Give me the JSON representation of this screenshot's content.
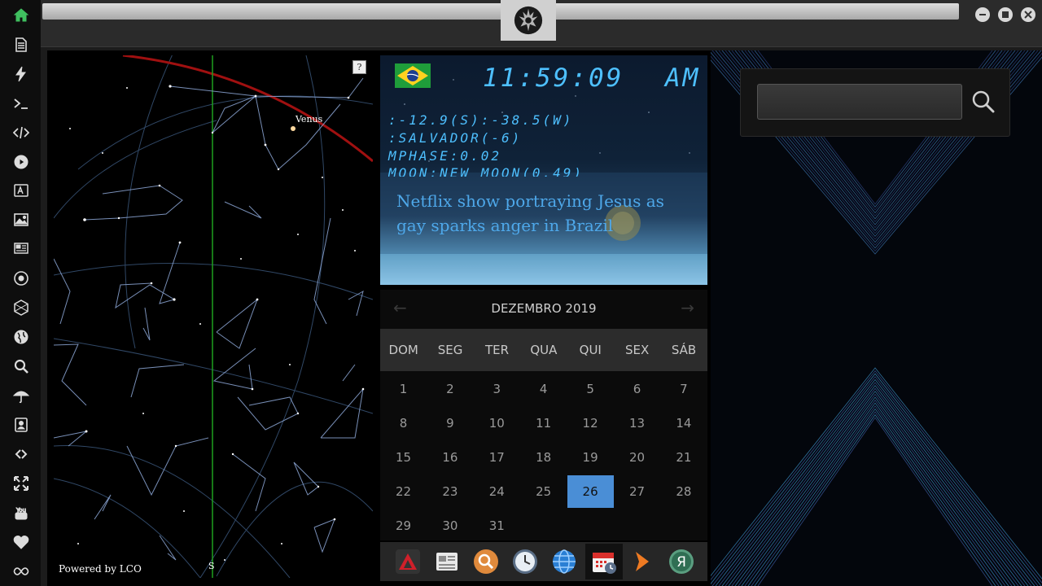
{
  "sidebar": {
    "items": [
      {
        "name": "home-icon",
        "color": "#3fbf5f"
      },
      {
        "name": "document-icon",
        "color": "#dcdcdc"
      },
      {
        "name": "lightning-icon",
        "color": "#dcdcdc"
      },
      {
        "name": "terminal-icon",
        "color": "#dcdcdc"
      },
      {
        "name": "code-icon",
        "color": "#dcdcdc"
      },
      {
        "name": "play-icon",
        "color": "#dcdcdc"
      },
      {
        "name": "translate-icon",
        "color": "#dcdcdc"
      },
      {
        "name": "image-icon",
        "color": "#dcdcdc"
      },
      {
        "name": "newspaper-icon",
        "color": "#dcdcdc"
      },
      {
        "name": "rebel-icon",
        "color": "#dcdcdc"
      },
      {
        "name": "hexagon-icon",
        "color": "#dcdcdc"
      },
      {
        "name": "globe-icon",
        "color": "#dcdcdc"
      },
      {
        "name": "search-icon",
        "color": "#dcdcdc"
      },
      {
        "name": "umbrella-icon",
        "color": "#dcdcdc"
      },
      {
        "name": "contact-icon",
        "color": "#dcdcdc"
      },
      {
        "name": "link-icon",
        "color": "#dcdcdc"
      },
      {
        "name": "expand-icon",
        "color": "#dcdcdc"
      },
      {
        "name": "youtube-icon",
        "color": "#dcdcdc"
      },
      {
        "name": "heart-icon",
        "color": "#dcdcdc"
      },
      {
        "name": "infinity-icon",
        "color": "#dcdcdc"
      }
    ]
  },
  "skymap": {
    "help": "?",
    "planet_label": "Venus",
    "powered_by": "Powered by LCO",
    "direction": "S"
  },
  "clock": {
    "time": "11:59:09",
    "ampm": "AM",
    "coords": ":-12.9(S):-38.5(W)",
    "city": ":SALVADOR(-6)",
    "mphase": "MPHASE:0.02",
    "moon": "MOON:NEW MOON(0.49)",
    "headline": "Netflix show portraying Jesus as gay sparks anger in Brazil"
  },
  "calendar": {
    "month_title": "DEZEMBRO 2019",
    "prev": "←",
    "next": "→",
    "weekdays": [
      "DOM",
      "SEG",
      "TER",
      "QUA",
      "QUI",
      "SEX",
      "SÁB"
    ],
    "weeks": [
      [
        "1",
        "2",
        "3",
        "4",
        "5",
        "6",
        "7"
      ],
      [
        "8",
        "9",
        "10",
        "11",
        "12",
        "13",
        "14"
      ],
      [
        "15",
        "16",
        "17",
        "18",
        "19",
        "20",
        "21"
      ],
      [
        "22",
        "23",
        "24",
        "25",
        "26",
        "27",
        "28"
      ],
      [
        "29",
        "30",
        "31",
        "",
        "",
        "",
        ""
      ]
    ],
    "today": "26",
    "accent": "#4a8ed6"
  },
  "dock": {
    "items": [
      {
        "name": "app-red-triangle-icon"
      },
      {
        "name": "news-reader-icon"
      },
      {
        "name": "search-app-icon"
      },
      {
        "name": "clock-app-icon"
      },
      {
        "name": "browser-globe-icon"
      },
      {
        "name": "calendar-app-icon"
      },
      {
        "name": "arrow-app-icon"
      },
      {
        "name": "yandex-icon"
      }
    ]
  },
  "search": {
    "value": "",
    "button_icon": "search-icon"
  }
}
